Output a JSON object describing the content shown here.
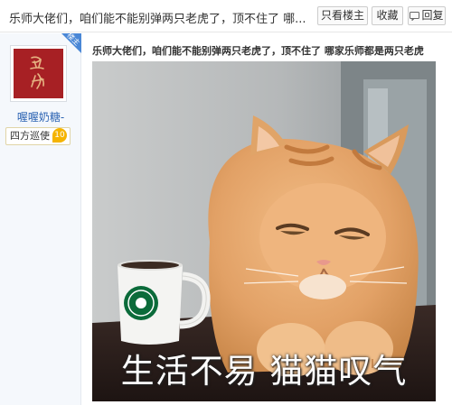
{
  "header": {
    "title": "乐师大佬们，咱们能不能别弹两只老虎了，顶不住了 哪...",
    "only_op_label": "只看楼主",
    "collect_label": "收藏",
    "reply_label": "回复"
  },
  "author": {
    "badge_label": "楼主",
    "avatar_icon": "red-seal-avatar",
    "username": "喔喔奶糖-",
    "title_label": "四方巡使",
    "level": "10",
    "level_color": "#f5b400"
  },
  "post": {
    "text": "乐师大佬们，咱们能不能别弹两只老虎了，顶不住了 哪家乐师都是两只老虎",
    "image_caption": "生活不易 猫猫叹气",
    "image_subject": "orange-tabby-cat-with-mug"
  },
  "colors": {
    "link": "#2d64b3",
    "sidebar_bg": "#f5f8fc",
    "badge_blue": "#4a87d6"
  }
}
